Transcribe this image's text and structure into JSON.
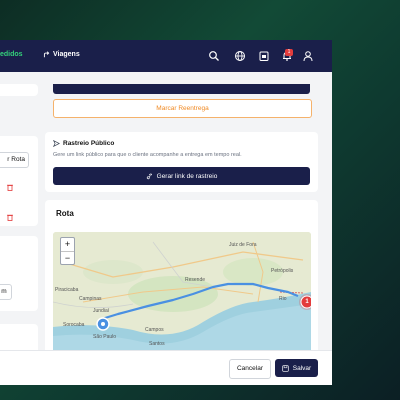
{
  "nav": {
    "partial_link": "edidos",
    "trips_label": "Viagens",
    "notification_count": "1",
    "icons": [
      "search-icon",
      "globe-icon",
      "calendar-icon",
      "bell-icon",
      "user-icon"
    ]
  },
  "left": {
    "gerar_rota_partial": "r Rota",
    "m_partial": "m"
  },
  "actions": {
    "reentrega_label": "Marcar Reentrega"
  },
  "rastreio": {
    "title": "Rastreio Público",
    "description": "Gere um link público para que o cliente acompanhe a entrega em tempo real.",
    "button_label": "Gerar link de rastreio"
  },
  "rota": {
    "title": "Rota",
    "zoom_in": "+",
    "zoom_out": "−",
    "cluster_count": "1",
    "places": [
      "Juiz de Fora",
      "Piracicaba",
      "Campinas",
      "Jundiaí",
      "Sorocaba",
      "São Paulo",
      "Campos",
      "Resende",
      "Petrópolis",
      "Rio de Janeiro",
      "Santos"
    ]
  },
  "footer": {
    "cancel_label": "Cancelar",
    "save_label": "Salvar"
  },
  "colors": {
    "navy": "#1a1f4a",
    "accent_green": "#34d17a",
    "orange": "#f08a24",
    "route_blue": "#4a90e2",
    "marker_red": "#e33c3c"
  }
}
